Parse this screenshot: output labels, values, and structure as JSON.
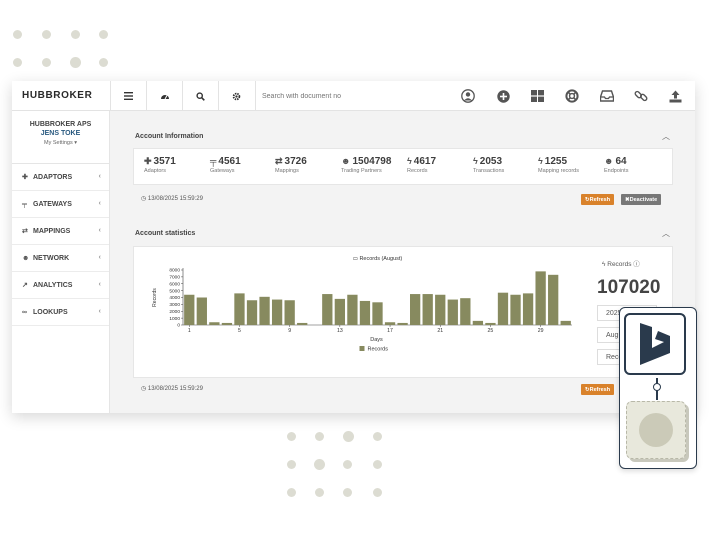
{
  "app": {
    "logo": "HUBBROKER"
  },
  "topbar": {
    "search_placeholder": "Search with document no",
    "left_icons": [
      "menu-icon",
      "dashboard-icon",
      "search-icon",
      "gear-icon"
    ],
    "right_icons": [
      "user-icon",
      "add-icon",
      "apps-grid-icon",
      "help-lifebuoy-icon",
      "inbox-icon",
      "link-icon",
      "upload-icon"
    ]
  },
  "sidebar": {
    "company": "HUBBROKER APS",
    "user": "JENS TOKE",
    "settings": "My Settings ▾",
    "items": [
      {
        "label": "ADAPTORS",
        "icon": "puzzle-icon",
        "glyph": "✚"
      },
      {
        "label": "GATEWAYS",
        "icon": "signpost-icon",
        "glyph": "╤"
      },
      {
        "label": "MAPPINGS",
        "icon": "exchange-icon",
        "glyph": "⇄"
      },
      {
        "label": "NETWORK",
        "icon": "users-icon",
        "glyph": "☻"
      },
      {
        "label": "ANALYTICS",
        "icon": "area-chart-icon",
        "glyph": "↗"
      },
      {
        "label": "LOOKUPS",
        "icon": "binoculars-icon",
        "glyph": "∞"
      }
    ]
  },
  "account_info": {
    "title": "Account Information",
    "stats": [
      {
        "value": "3571",
        "label": "Adaptors",
        "glyph": "✚"
      },
      {
        "value": "4561",
        "label": "Gateways",
        "glyph": "╤"
      },
      {
        "value": "3726",
        "label": "Mappings",
        "glyph": "⇄"
      },
      {
        "value": "1504798",
        "label": "Trading Partners",
        "glyph": "☻"
      },
      {
        "value": "4617",
        "label": "Records",
        "glyph": "ϟ"
      },
      {
        "value": "2053",
        "label": "Transactions",
        "glyph": "ϟ"
      },
      {
        "value": "1255",
        "label": "Mapping records",
        "glyph": "ϟ"
      },
      {
        "value": "64",
        "label": "Endpoints",
        "glyph": "☻"
      }
    ],
    "timestamp": "13/08/2025 15:59:29",
    "refresh_label": "Refresh",
    "deactivate_label": "Deactivate"
  },
  "account_stats": {
    "title": "Account statistics",
    "records_label": "Records",
    "records_total": "107020",
    "controls": [
      "2025",
      "August",
      "Records"
    ],
    "timestamp": "13/08/2025 15:59:29",
    "refresh_label": "Refresh"
  },
  "chart_data": {
    "type": "bar",
    "title": "Records (August)",
    "xlabel": "Days",
    "ylabel": "Records",
    "ylim": [
      0,
      8000
    ],
    "yticks": [
      0,
      1000,
      2000,
      3000,
      4000,
      5000,
      6000,
      7000,
      8000
    ],
    "xticks": [
      "1",
      "5",
      "9",
      "13",
      "17",
      "21",
      "25",
      "29"
    ],
    "categories": [
      "1",
      "2",
      "3",
      "4",
      "5",
      "6",
      "7",
      "8",
      "9",
      "10",
      "11",
      "12",
      "13",
      "14",
      "15",
      "16",
      "17",
      "18",
      "19",
      "20",
      "21",
      "22",
      "23",
      "24",
      "25",
      "26",
      "27",
      "28",
      "29",
      "30",
      "31"
    ],
    "series": [
      {
        "name": "Records",
        "color": "#878a5f",
        "values": [
          4400,
          4000,
          400,
          300,
          4600,
          3600,
          4100,
          3700,
          3600,
          300,
          0,
          4500,
          3800,
          4400,
          3500,
          3300,
          400,
          300,
          4500,
          4500,
          4400,
          3700,
          3900,
          600,
          300,
          4700,
          4400,
          4600,
          7800,
          7300,
          600
        ]
      }
    ],
    "legend": "bottom",
    "grid": false
  },
  "colors": {
    "bar": "#878a5f",
    "refresh": "#d9822b",
    "deactivate": "#777777",
    "accent": "#2a5a80"
  }
}
